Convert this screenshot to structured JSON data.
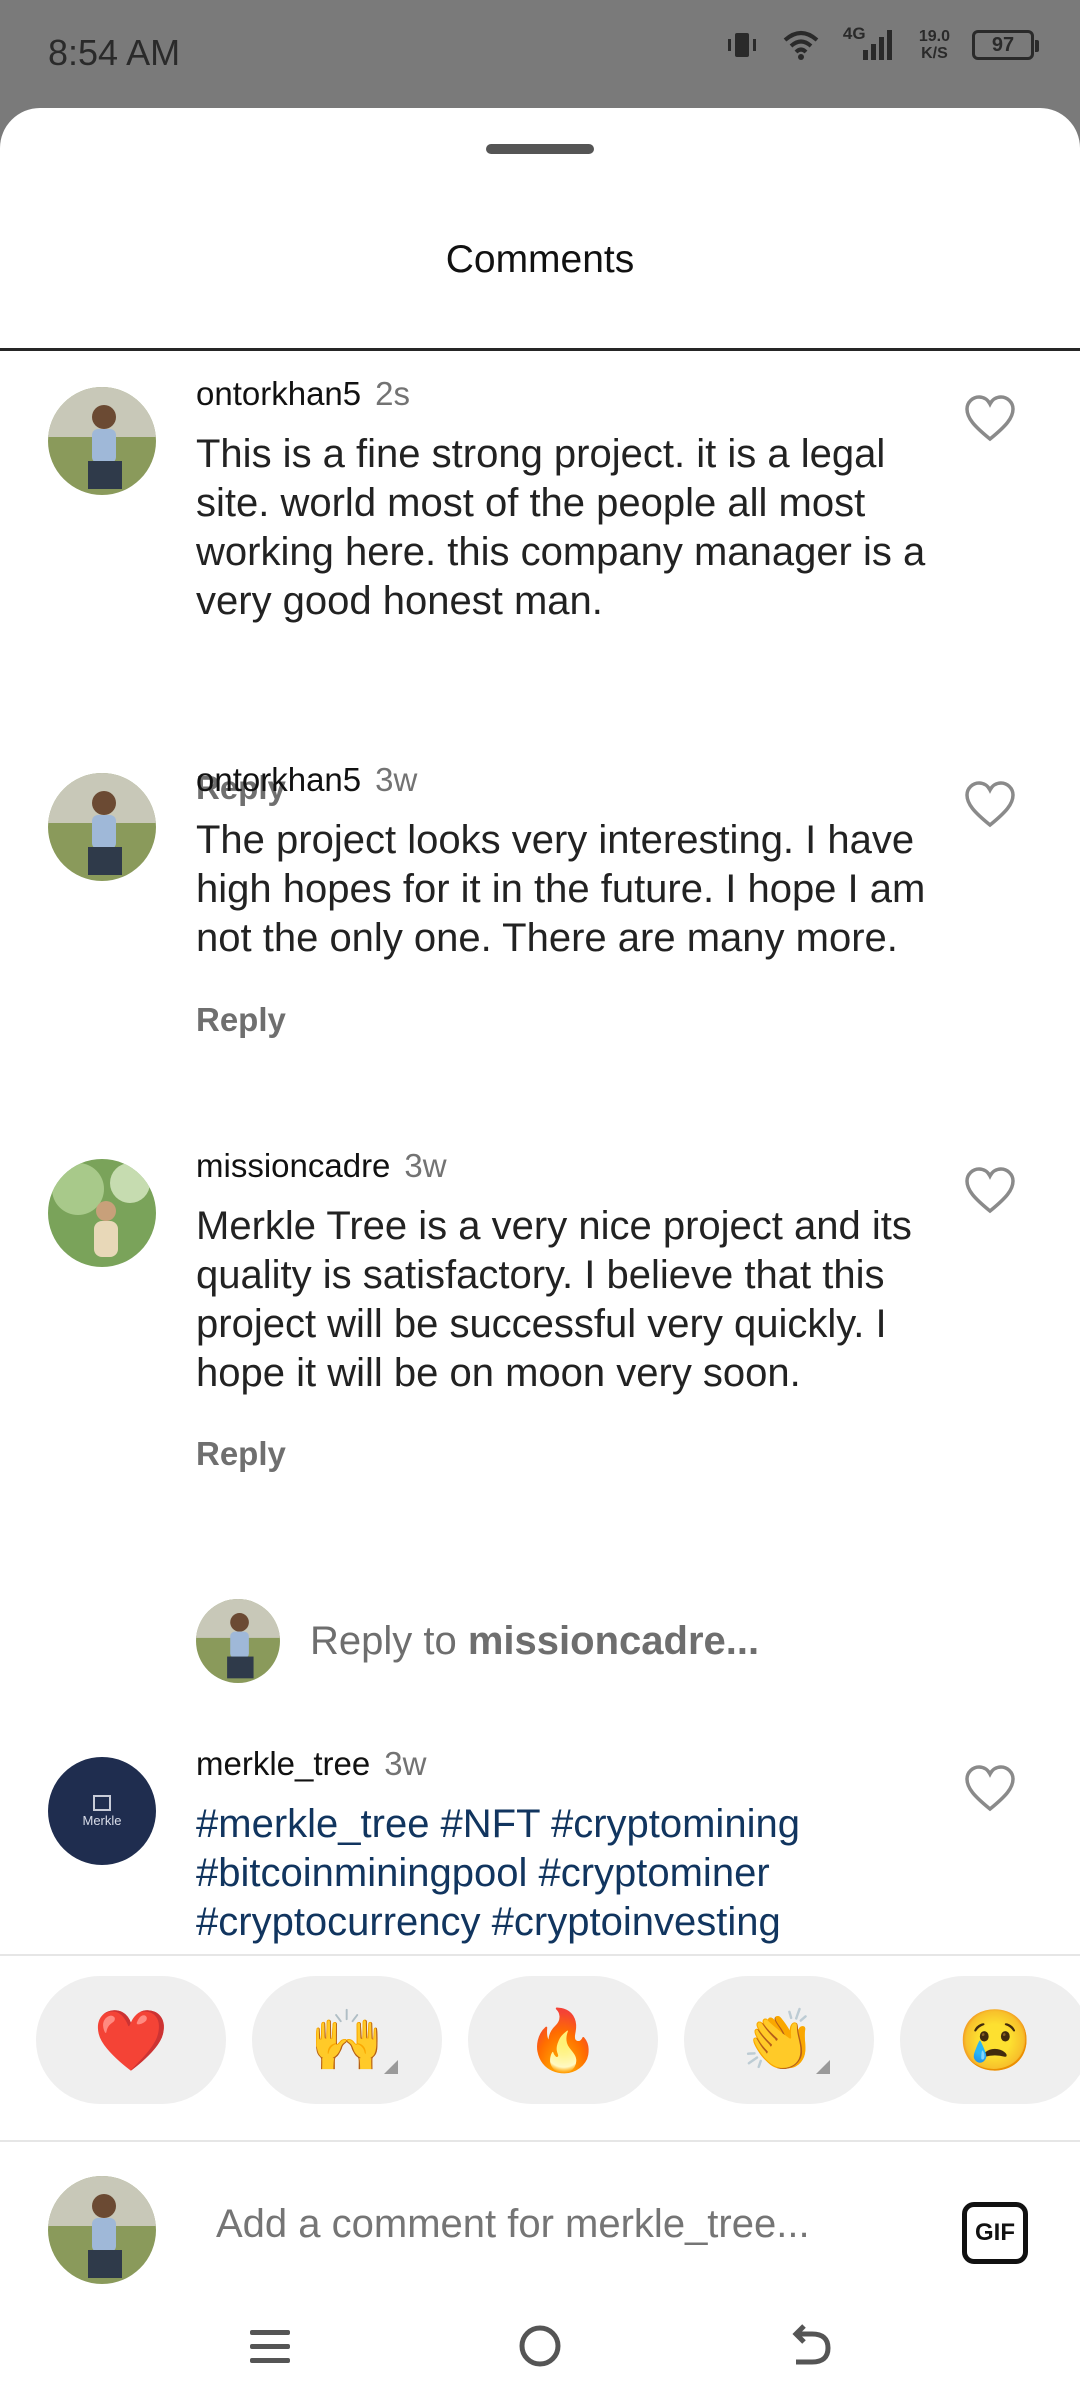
{
  "status": {
    "time": "8:54 AM",
    "network": "4G",
    "speed_value": "19.0",
    "speed_unit": "K/S",
    "battery": "97"
  },
  "sheet": {
    "title": "Comments"
  },
  "comments": [
    {
      "username": "ontorkhan5",
      "time": "2s",
      "text": "This is a fine strong project. it is a legal site. world most of the people all most working here. this company manager is a very good honest man.",
      "reply_label": "Reply"
    },
    {
      "username": "ontorkhan5",
      "time": "3w",
      "text": "The project looks very interesting. I have high hopes for it in the future. I hope I am not the only one. There are many more.",
      "reply_label": "Reply"
    },
    {
      "username": "missioncadre",
      "time": "3w",
      "text": "Merkle Tree is a very nice project and its quality is satisfactory. I believe that this project will be successful very quickly. I hope it will be on moon very soon.",
      "reply_label": "Reply"
    },
    {
      "username": "merkle_tree",
      "time": "3w",
      "text": "#merkle_tree #NFT #cryptomining #bitcoinminingpool #cryptominer #cryptocurrency #cryptoinvesting",
      "avatar_text": "Merkle"
    }
  ],
  "reply_prompt": {
    "prefix": "Reply to ",
    "target": "missioncadre..."
  },
  "emoji_bar": [
    {
      "emoji": "❤️",
      "name": "red-heart-emoji"
    },
    {
      "emoji": "🙌",
      "name": "raising-hands-emoji"
    },
    {
      "emoji": "🔥",
      "name": "fire-emoji"
    },
    {
      "emoji": "👏",
      "name": "clapping-hands-emoji"
    },
    {
      "emoji": "😢",
      "name": "crying-face-emoji"
    }
  ],
  "compose": {
    "placeholder": "Add a comment for merkle_tree...",
    "gif_label": "GIF"
  },
  "colors": {
    "hashtag": "#11355f",
    "muted": "#737373",
    "statusbar": "#7a7a7a"
  }
}
